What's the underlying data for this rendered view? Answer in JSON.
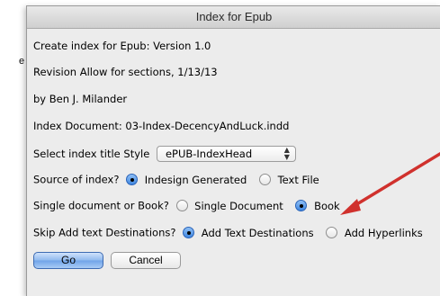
{
  "window": {
    "title": "Index for Epub"
  },
  "info_lines": {
    "create": "Create index for Epub:  Version 1.0",
    "revision": "Revision Allow for sections, 1/13/13",
    "author": "by Ben J. Milander",
    "index_doc": "Index Document: 03-Index-DecencyAndLuck.indd"
  },
  "title_style": {
    "label": "Select index title Style",
    "selected": "ePUB-IndexHead"
  },
  "source": {
    "label": "Source of index?",
    "options": [
      "Indesign Generated",
      "Text File"
    ],
    "selected": "Indesign Generated"
  },
  "doc_type": {
    "label": "Single document or Book?",
    "options": [
      "Single Document",
      "Book"
    ],
    "selected": "Book"
  },
  "destinations": {
    "label": "Skip Add text Destinations?",
    "options": [
      "Add Text Destinations",
      "Add Hyperlinks"
    ],
    "selected": "Add Text Destinations"
  },
  "buttons": {
    "go": "Go",
    "cancel": "Cancel"
  },
  "background": {
    "fragment_char": "e"
  },
  "colors": {
    "arrow": "#d0312d",
    "default_button": "#6fa3e8"
  }
}
